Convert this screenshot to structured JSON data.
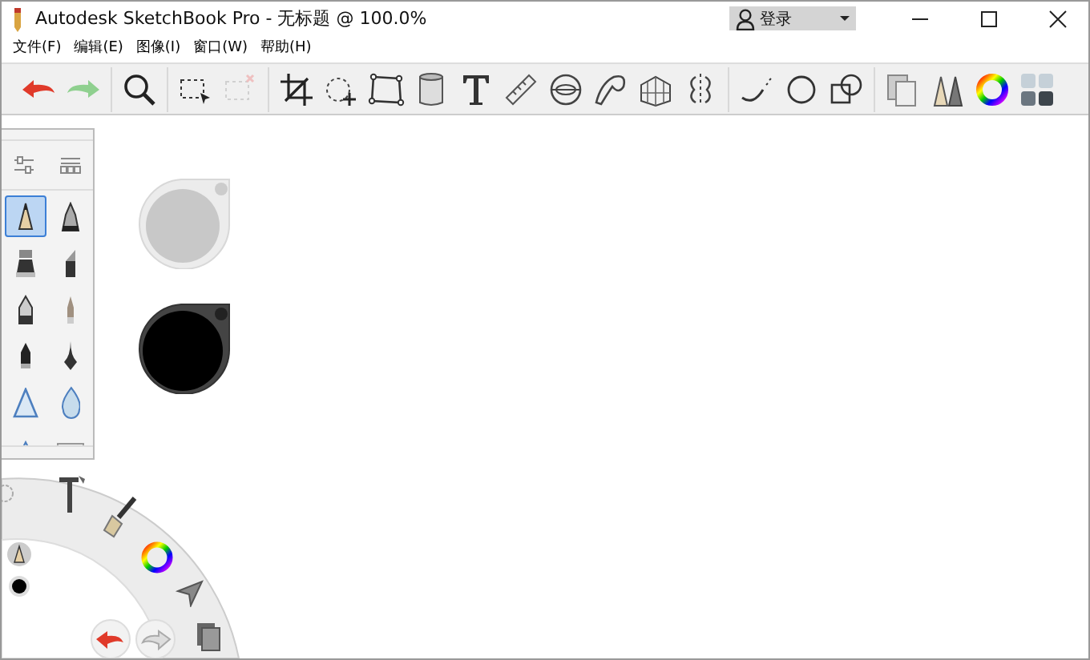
{
  "window": {
    "title": "Autodesk SketchBook Pro - 无标题 @ 100.0%"
  },
  "account": {
    "label": "登录"
  },
  "menu": [
    "文件(F)",
    "编辑(E)",
    "图像(I)",
    "窗口(W)",
    "帮助(H)"
  ],
  "toolbar": [
    {
      "kind": "undo",
      "disabled": false
    },
    {
      "kind": "redo",
      "disabled": false
    },
    {
      "kind": "zoom",
      "disabled": false
    },
    {
      "kind": "select",
      "disabled": false
    },
    {
      "kind": "deselect",
      "disabled": true
    },
    {
      "kind": "crop",
      "disabled": false
    },
    {
      "kind": "transform",
      "disabled": false
    },
    {
      "kind": "distort",
      "disabled": false
    },
    {
      "kind": "fill",
      "disabled": false
    },
    {
      "kind": "text",
      "disabled": false
    },
    {
      "kind": "ruler",
      "disabled": false
    },
    {
      "kind": "ellipse",
      "disabled": false
    },
    {
      "kind": "curve",
      "disabled": false
    },
    {
      "kind": "perspective",
      "disabled": false
    },
    {
      "kind": "symmetry",
      "disabled": false
    },
    {
      "kind": "line",
      "disabled": false
    },
    {
      "kind": "circle",
      "disabled": false
    },
    {
      "kind": "shapes",
      "disabled": false
    },
    {
      "kind": "layers",
      "disabled": false
    },
    {
      "kind": "brushes",
      "disabled": false
    },
    {
      "kind": "colors",
      "disabled": false
    },
    {
      "kind": "copic",
      "disabled": false
    }
  ],
  "brushes": [
    {
      "selected": true
    },
    {
      "selected": false
    },
    {
      "selected": false
    },
    {
      "selected": false
    },
    {
      "selected": false
    },
    {
      "selected": false
    },
    {
      "selected": false
    },
    {
      "selected": false
    },
    {
      "selected": false
    },
    {
      "selected": false
    },
    {
      "selected": false
    },
    {
      "selected": false
    }
  ],
  "pucks": [
    {
      "color": "#c8c8c8"
    },
    {
      "color": "#000000"
    }
  ]
}
